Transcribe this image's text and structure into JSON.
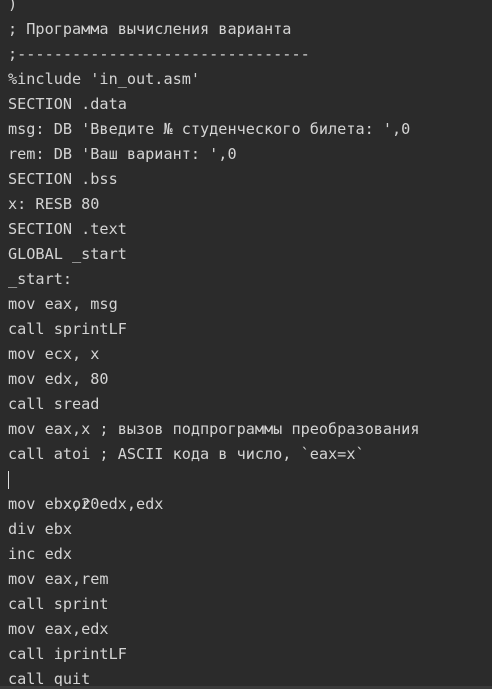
{
  "editor": {
    "lines": [
      ")",
      "; Программа вычисления варианта",
      ";--------------------------------",
      "%include 'in_out.asm'",
      "SECTION .data",
      "msg: DB 'Введите № студенческого билета: ',0",
      "rem: DB 'Ваш вариант: ',0",
      "SECTION .bss",
      "x: RESB 80",
      "SECTION .text",
      "GLOBAL _start",
      "_start:",
      "mov eax, msg",
      "call sprintLF",
      "mov ecx, x",
      "mov edx, 80",
      "call sread",
      "mov eax,x ; вызов подпрограммы преобразования",
      "call atoi ; ASCII кода в число, `eax=x`",
      "xor edx,edx",
      "mov ebx,20",
      "div ebx",
      "inc edx",
      "mov eax,rem",
      "call sprint",
      "mov eax,edx",
      "call iprintLF",
      "call quit"
    ],
    "cursor_line": 19
  },
  "colors": {
    "background": "#2b2b2b",
    "text": "#d4d4d4",
    "spellcheck_underline": "#e01b24"
  }
}
